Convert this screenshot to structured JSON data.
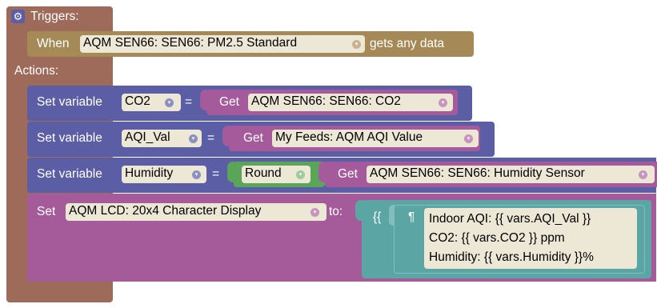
{
  "triggers": {
    "label": "Triggers:",
    "gear_icon": "gear-icon",
    "when_label": "When",
    "feed": "AQM SEN66: SEN66: PM2.5 Standard",
    "suffix": "gets any data"
  },
  "actions": {
    "label": "Actions:",
    "blocks": [
      {
        "set_label": "Set variable",
        "var": "CO2",
        "eq": "=",
        "get_label": "Get",
        "feed": "AQM SEN66: SEN66: CO2"
      },
      {
        "set_label": "Set variable",
        "var": "AQI_Val",
        "eq": "=",
        "get_label": "Get",
        "feed": "My Feeds: AQM AQI Value"
      },
      {
        "set_label": "Set variable",
        "var": "Humidity",
        "eq": "=",
        "round_label": "Round",
        "get_label": "Get",
        "feed": "AQM SEN66: SEN66: Humidity Sensor"
      }
    ],
    "display": {
      "set_label": "Set",
      "target": "AQM LCD: 20x4 Character Display",
      "to_label": "to:",
      "template_braces": "{{",
      "pilcrow": "¶",
      "lines": [
        "Indoor AQI: {{ vars.AQI_Val }}",
        "CO2: {{ vars.CO2 }} ppm",
        "Humidity: {{ vars.Humidity }}%"
      ]
    }
  },
  "colors": {
    "root": "#9e6a59",
    "trigger": "#a58a57",
    "variable": "#5c5ea5",
    "getter": "#a55b9b",
    "round": "#5ba55b",
    "display": "#a55b99",
    "template": "#5ba5a5",
    "field_bg": "#ede7d6"
  },
  "icons": {
    "dropdown": "▾"
  }
}
